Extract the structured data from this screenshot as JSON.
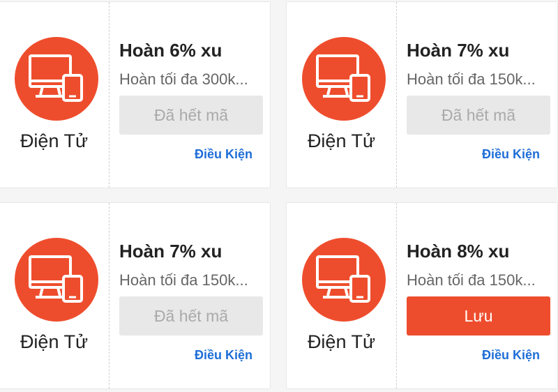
{
  "vouchers": [
    {
      "category": "Điện Tử",
      "title": "Hoàn 6% xu",
      "subtitle": "Hoàn tối đa 300k...",
      "button": "Đã hết mã",
      "button_state": "disabled",
      "condition": "Điều Kiện"
    },
    {
      "category": "Điện Tử",
      "title": "Hoàn 7% xu",
      "subtitle": "Hoàn tối đa 150k...",
      "button": "Đã hết mã",
      "button_state": "disabled",
      "condition": "Điều Kiện"
    },
    {
      "category": "Điện Tử",
      "title": "Hoàn 7% xu",
      "subtitle": "Hoàn tối đa 150k...",
      "button": "Đã hết mã",
      "button_state": "disabled",
      "condition": "Điều Kiện"
    },
    {
      "category": "Điện Tử",
      "title": "Hoàn 8% xu",
      "subtitle": "Hoàn tối đa 150k...",
      "button": "Lưu",
      "button_state": "active",
      "condition": "Điều Kiện"
    }
  ],
  "icon": "computer-tablet-icon",
  "colors": {
    "accent": "#ee4d2d",
    "link": "#1e6ed7",
    "disabled_bg": "#e8e8e8",
    "disabled_text": "#aaaaaa"
  }
}
